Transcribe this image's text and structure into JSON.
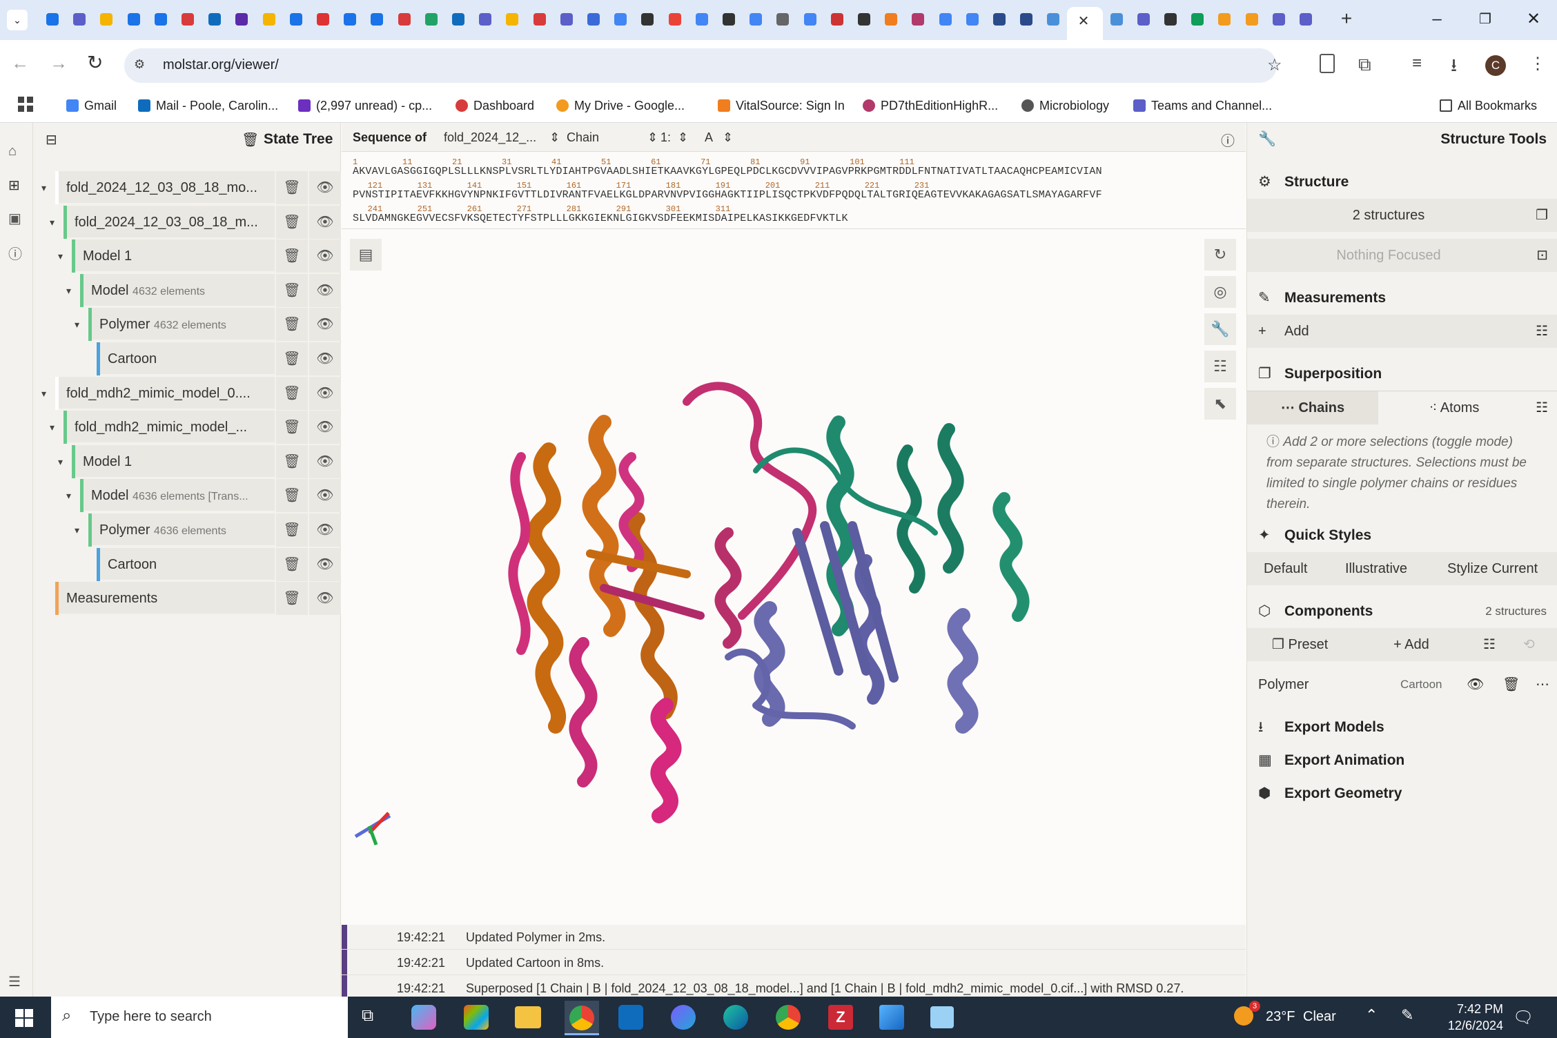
{
  "browser": {
    "url": "molstar.org/viewer/",
    "profile_initial": "C",
    "bookmarks": [
      "Gmail",
      "Mail - Poole, Carolin...",
      "(2,997 unread) - cp...",
      "Dashboard",
      "My Drive - Google...",
      "VitalSource: Sign In",
      "PD7thEditionHighR...",
      "Microbiology",
      "Teams and Channel..."
    ],
    "all_bookmarks": "All Bookmarks"
  },
  "state_tree": {
    "title": "State Tree",
    "nodes": [
      {
        "label": "fold_2024_12_03_08_18_mo...",
        "sub": "",
        "indent": 0,
        "color": "#ffffff"
      },
      {
        "label": "fold_2024_12_03_08_18_m...",
        "sub": "",
        "indent": 1,
        "color": "#67c98a"
      },
      {
        "label": "Model 1",
        "sub": "",
        "indent": 2,
        "color": "#67c98a"
      },
      {
        "label": "Model",
        "sub": "4632 elements",
        "indent": 3,
        "color": "#67c98a"
      },
      {
        "label": "Polymer",
        "sub": "4632 elements",
        "indent": 4,
        "color": "#67c98a"
      },
      {
        "label": "Cartoon",
        "sub": "",
        "indent": 5,
        "color": "#4aa3df"
      },
      {
        "label": "fold_mdh2_mimic_model_0....",
        "sub": "",
        "indent": 0,
        "color": "#ffffff"
      },
      {
        "label": "fold_mdh2_mimic_model_...",
        "sub": "",
        "indent": 1,
        "color": "#67c98a"
      },
      {
        "label": "Model 1",
        "sub": "",
        "indent": 2,
        "color": "#67c98a"
      },
      {
        "label": "Model",
        "sub": "4636 elements [Trans...",
        "indent": 3,
        "color": "#67c98a"
      },
      {
        "label": "Polymer",
        "sub": "4636 elements",
        "indent": 4,
        "color": "#67c98a"
      },
      {
        "label": "Cartoon",
        "sub": "",
        "indent": 5,
        "color": "#4aa3df"
      },
      {
        "label": "Measurements",
        "sub": "",
        "indent": 0,
        "color": "#f0a35a"
      }
    ]
  },
  "sequence": {
    "label": "Sequence of",
    "structure_select": "fold_2024_12_...",
    "mode_select": "Chain",
    "entity_select": "1:",
    "chain_select": "A",
    "rows": [
      {
        "nums": "1         11        21        31        41        51        61        71        81        91        101       111",
        "seq": "AKVAVLGASGGIGQPLSLLLKNSPLVSRLTLYDIAHTPGVAADLSHIETKAAVKGYLGPEQLPDCLKGCDVVVIPAGVPRKPGMTRDDLFNTNATIVATLTAACAQHCPEAMICVIAN"
      },
      {
        "nums": "   121       131       141       151       161       171       181       191       201       211       221       231",
        "seq": "PVNSTIPITAEVFKKHGVYNPNKIFGVTTLDIVRANTFVAELKGLDPARVNVPVIGGHAGKTIIPLISQCTPKVDFPQDQLTALTGRIQEAGTEVVKAKAGAGSATLSMAYAGARFVF"
      },
      {
        "nums": "   241       251       261       271       281       291       301       311",
        "seq": "SLVDAMNGKEGVVECSFVKSQETECTYFSTPLLLGKKGIEKNLGIGKVSDFEEKMISDAIPELKASIKKGEDFVKTLK"
      }
    ]
  },
  "log": [
    {
      "time": "19:42:21",
      "msg": "Updated Polymer in 2ms."
    },
    {
      "time": "19:42:21",
      "msg": "Updated Cartoon in 8ms."
    },
    {
      "time": "19:42:21",
      "msg": "Superposed [1 Chain | B | fold_2024_12_03_08_18_model...] and [1 Chain | B | fold_mdh2_mimic_model_0.cif...] with RMSD 0.27."
    }
  ],
  "structure_tools": {
    "title": "Structure Tools",
    "structure_section": "Structure",
    "structures_count": "2 structures",
    "focus_text": "Nothing Focused",
    "measurements_section": "Measurements",
    "add_label": "Add",
    "superposition_section": "Superposition",
    "chains_tab": "Chains",
    "atoms_tab": "Atoms",
    "superposition_hint": "Add 2 or more selections (toggle mode) from separate structures. Selections must be limited to single polymer chains or residues therein.",
    "quick_styles_section": "Quick Styles",
    "styles": [
      "Default",
      "Illustrative",
      "Stylize Current"
    ],
    "components_section": "Components",
    "components_count": "2 structures",
    "preset_label": "Preset",
    "component_add": "Add",
    "component_name": "Polymer",
    "component_repr": "Cartoon",
    "export_models": "Export Models",
    "export_animation": "Export Animation",
    "export_geometry": "Export Geometry"
  },
  "taskbar": {
    "search_placeholder": "Type here to search",
    "weather_temp": "23°F",
    "weather_cond": "Clear",
    "weather_badge": "3",
    "time": "7:42 PM",
    "date": "12/6/2024"
  }
}
